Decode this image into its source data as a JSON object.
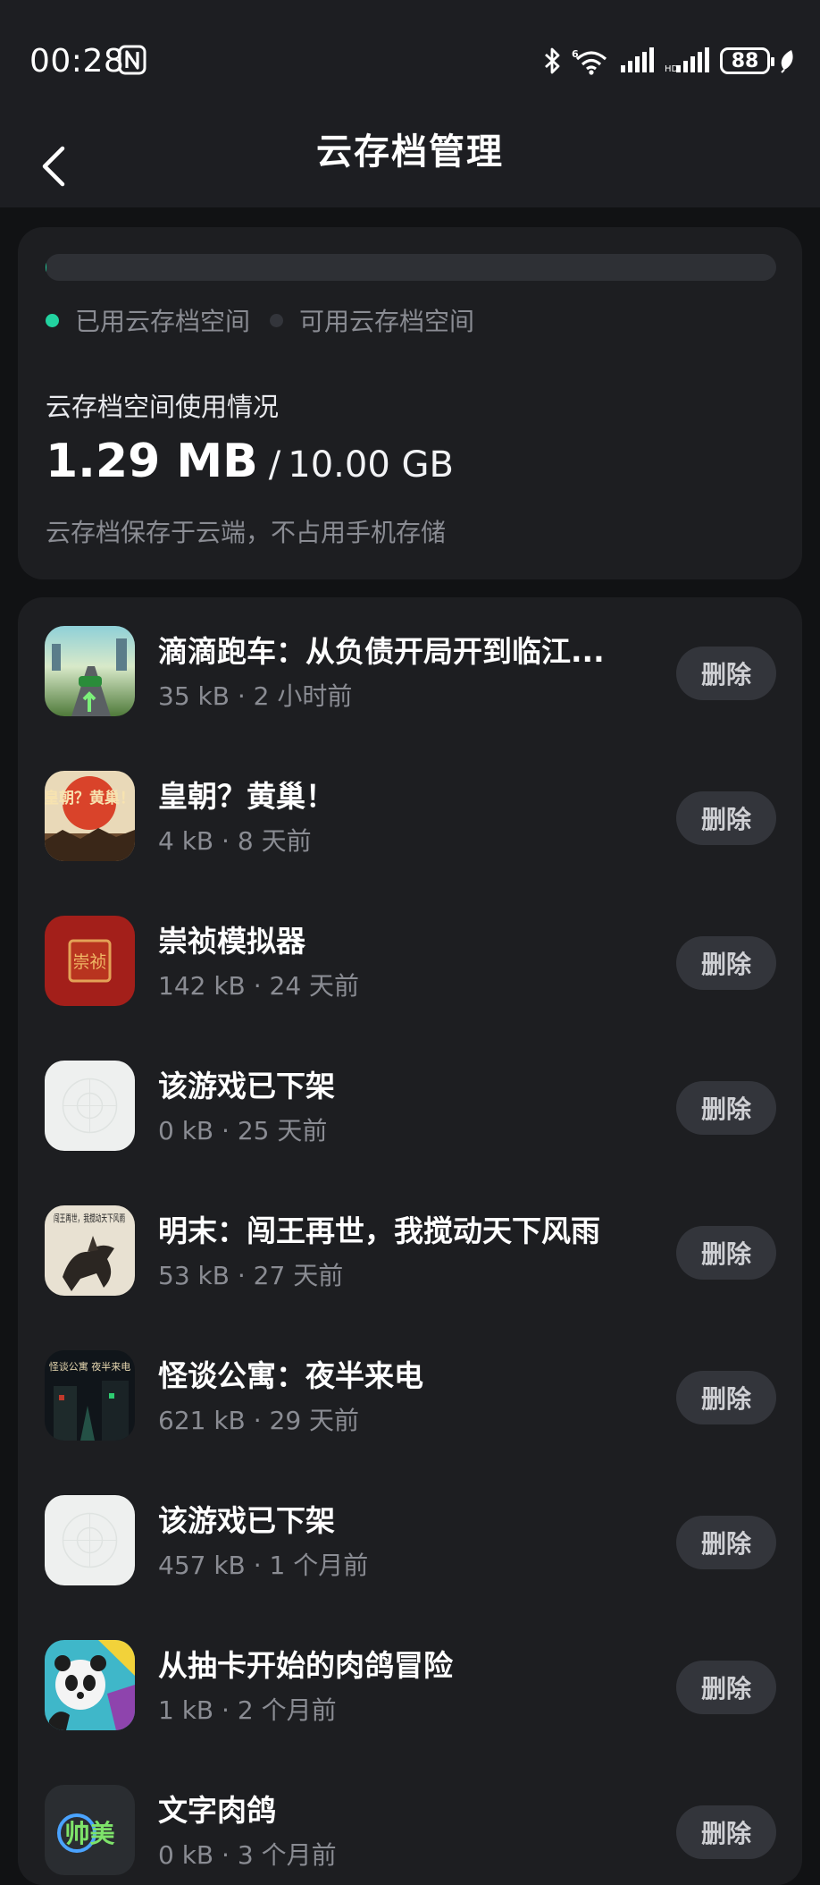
{
  "status_bar": {
    "time": "00:28",
    "battery": "88"
  },
  "header": {
    "title": "云存档管理"
  },
  "usage": {
    "legend_used": "已用云存档空间",
    "legend_available": "可用云存档空间",
    "used_fraction": 0.000126,
    "label": "云存档空间使用情况",
    "used": "1.29 MB",
    "separator": "/",
    "total": "10.00 GB",
    "note": "云存档保存于云端，不占用手机存储",
    "colors": {
      "used": "#22d3a0",
      "available": "#2e3035"
    }
  },
  "saves": [
    {
      "title": "滴滴跑车：从负债开局开到临江...",
      "size": "35 kB",
      "time": "2 小时前",
      "delete_label": "删除",
      "icon": "racing-car-game-icon"
    },
    {
      "title": "皇朝？黄巢！",
      "size": "4 kB",
      "time": "8 天前",
      "delete_label": "删除",
      "icon": "dynasty-game-icon",
      "icon_text": "皇朝？黄巢！"
    },
    {
      "title": "崇祯模拟器",
      "size": "142 kB",
      "time": "24 天前",
      "delete_label": "删除",
      "icon": "chongzhen-seal-icon",
      "icon_text": "崇祯"
    },
    {
      "title": "该游戏已下架",
      "size": "0 kB",
      "time": "25 天前",
      "delete_label": "删除",
      "icon": "placeholder-game-icon"
    },
    {
      "title": "明末：闯王再世，我搅动天下风雨",
      "size": "53 kB",
      "time": "27 天前",
      "delete_label": "删除",
      "icon": "horseman-painting-icon",
      "icon_text": "闯王再世，我搅动天下风雨"
    },
    {
      "title": "怪谈公寓：夜半来电",
      "size": "621 kB",
      "time": "29 天前",
      "delete_label": "删除",
      "icon": "haunted-apartment-icon",
      "icon_text": "怪谈公寓 夜半来电"
    },
    {
      "title": "该游戏已下架",
      "size": "457 kB",
      "time": "1 个月前",
      "delete_label": "删除",
      "icon": "placeholder-game-icon"
    },
    {
      "title": "从抽卡开始的肉鸽冒险",
      "size": "1 kB",
      "time": "2 个月前",
      "delete_label": "删除",
      "icon": "panda-game-icon"
    },
    {
      "title": "文字肉鸽",
      "size": "0 kB",
      "time": "3 个月前",
      "delete_label": "删除",
      "icon": "text-roguelike-icon",
      "icon_text": "帅美"
    }
  ],
  "meta_separator": "·"
}
